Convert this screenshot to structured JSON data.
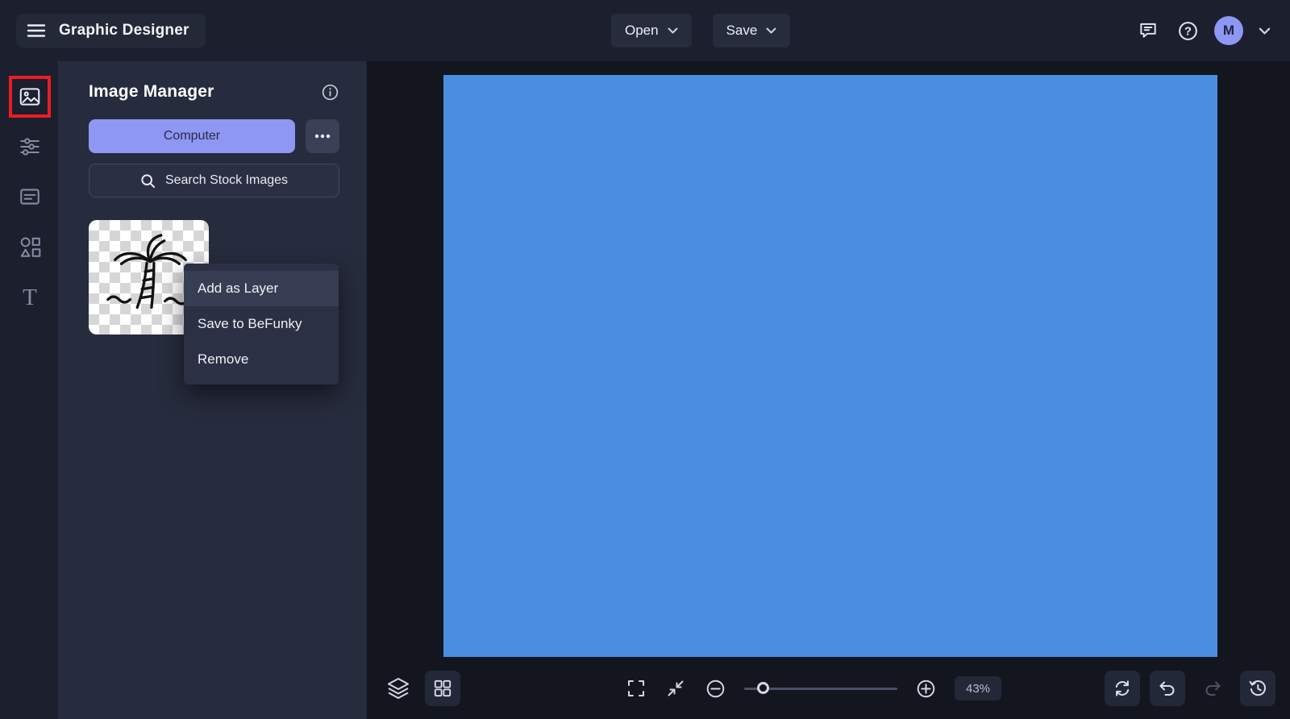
{
  "topbar": {
    "title": "Graphic Designer",
    "open_label": "Open",
    "save_label": "Save",
    "avatar_initial": "M"
  },
  "panel": {
    "title": "Image Manager",
    "computer_label": "Computer",
    "search_label": "Search Stock Images"
  },
  "context_menu": {
    "items": [
      "Add as Layer",
      "Save to BeFunky",
      "Remove"
    ],
    "active_index": 0
  },
  "toolbar": {
    "zoom_level": "43%"
  },
  "icons": {
    "help_glyph": "?",
    "text_glyph": "T",
    "hamburger": "menu",
    "comments": "speech-bubble",
    "info": "info-circle",
    "search": "magnifier",
    "more": "ellipsis",
    "rail": [
      "image-manager",
      "edit-sliders",
      "templates",
      "graphics-shapes",
      "text"
    ],
    "bottom": [
      "layers",
      "grid",
      "fit-screen",
      "collapse",
      "zoom-out",
      "zoom-slider",
      "zoom-in",
      "reset",
      "undo",
      "redo",
      "history"
    ]
  },
  "colors": {
    "accent": "#8e97f3",
    "canvas_blue": "#4a8ee2",
    "annotation_red": "#ec1c24",
    "topbar_bg": "#1c1f2e",
    "panel_bg": "#262b3d",
    "canvas_bg": "#13151f"
  },
  "thumbnail": {
    "description": "palm-tree-line-art-on-transparent-checkerboard"
  }
}
